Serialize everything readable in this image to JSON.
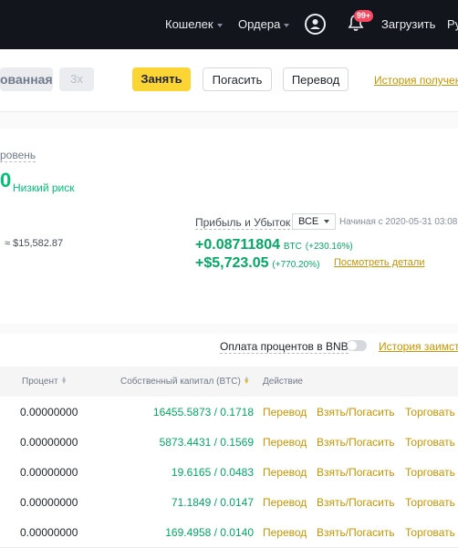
{
  "header": {
    "nav": {
      "wallet": "Кошелек",
      "orders": "Ордера",
      "download": "Загрузить",
      "lang": "Ру"
    },
    "notifications_badge": "99+"
  },
  "toolbar": {
    "margin_mode": "ованная",
    "leverage": "3x",
    "borrow": "Занять",
    "repay": "Погасить",
    "transfer": "Перевод",
    "borrow_history": "История получен"
  },
  "risk": {
    "label": "ровень",
    "value": "0",
    "status": "Низкий риск"
  },
  "account": {
    "equity_usd": "≈ $15,582.87"
  },
  "pnl": {
    "label": "Прибыль и Убыток",
    "period": "ВСЕ",
    "since": "Начиная с 2020-05-31 03:08",
    "btc_value": "+0.08711804",
    "btc_unit": "BTC",
    "btc_pct": "(+230.16%)",
    "usd_value": "+$5,723.05",
    "usd_pct": "(+770.20%)",
    "details": "Посмотреть детали"
  },
  "assets": {
    "bnb_interest_label": "Оплата процентов в BNB",
    "bnb_interest_enabled": false,
    "interest_history": "История заимств",
    "columns": {
      "percent": "Процент",
      "equity": "Собственный капитал (BTC)",
      "action": "Действие"
    },
    "rows": [
      {
        "percent": "0.00000000",
        "equity": "16455.5873 / 0.1718"
      },
      {
        "percent": "0.00000000",
        "equity": "5873.4431 / 0.1569"
      },
      {
        "percent": "0.00000000",
        "equity": "19.6165 / 0.0483"
      },
      {
        "percent": "0.00000000",
        "equity": "71.1849 / 0.0147"
      },
      {
        "percent": "0.00000000",
        "equity": "169.4958 / 0.0140"
      }
    ],
    "actions": {
      "transfer": "Перевод",
      "borrow_repay": "Взять/Погасить",
      "trade": "Торговать"
    }
  },
  "colors": {
    "accent": "#fcd535",
    "positive": "#02c076",
    "link": "#c99400",
    "topbar": "#12161c"
  }
}
